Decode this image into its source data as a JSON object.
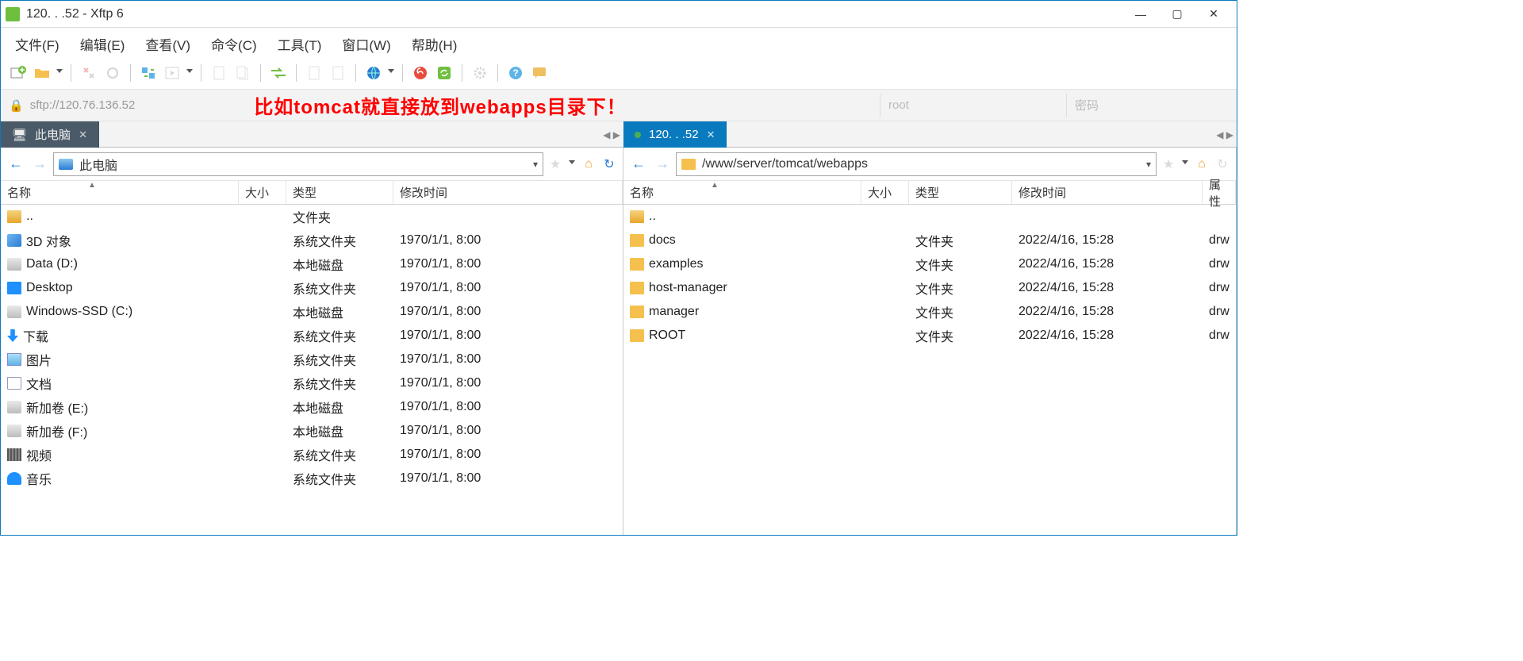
{
  "window": {
    "title": "120.  .  .52 - Xftp 6"
  },
  "menu": [
    "文件(F)",
    "编辑(E)",
    "查看(V)",
    "命令(C)",
    "工具(T)",
    "窗口(W)",
    "帮助(H)"
  ],
  "address": {
    "url": "sftp://120.76.136.52",
    "overlay": "比如tomcat就直接放到webapps目录下！",
    "user_placeholder": "root",
    "pass_placeholder": "密码"
  },
  "tabs": {
    "local": "此电脑",
    "remote": "120.  .  .52"
  },
  "local": {
    "path": "此电脑",
    "cols": {
      "name": "名称",
      "size": "大小",
      "type": "类型",
      "mtime": "修改时间"
    },
    "rows": [
      {
        "icon": "fold-o",
        "name": "..",
        "type": "文件夹",
        "mtime": ""
      },
      {
        "icon": "cube",
        "name": "3D 对象",
        "type": "系统文件夹",
        "mtime": "1970/1/1, 8:00"
      },
      {
        "icon": "hdd",
        "name": "Data (D:)",
        "type": "本地磁盘",
        "mtime": "1970/1/1, 8:00"
      },
      {
        "icon": "desk",
        "name": "Desktop",
        "type": "系统文件夹",
        "mtime": "1970/1/1, 8:00"
      },
      {
        "icon": "hdd",
        "name": "Windows-SSD (C:)",
        "type": "本地磁盘",
        "mtime": "1970/1/1, 8:00"
      },
      {
        "icon": "dl",
        "name": "下载",
        "type": "系统文件夹",
        "mtime": "1970/1/1, 8:00"
      },
      {
        "icon": "img",
        "name": "图片",
        "type": "系统文件夹",
        "mtime": "1970/1/1, 8:00"
      },
      {
        "icon": "doc",
        "name": "文档",
        "type": "系统文件夹",
        "mtime": "1970/1/1, 8:00"
      },
      {
        "icon": "hdd",
        "name": "新加卷 (E:)",
        "type": "本地磁盘",
        "mtime": "1970/1/1, 8:00"
      },
      {
        "icon": "hdd",
        "name": "新加卷 (F:)",
        "type": "本地磁盘",
        "mtime": "1970/1/1, 8:00"
      },
      {
        "icon": "vid",
        "name": "视频",
        "type": "系统文件夹",
        "mtime": "1970/1/1, 8:00"
      },
      {
        "icon": "mus",
        "name": "音乐",
        "type": "系统文件夹",
        "mtime": "1970/1/1, 8:00"
      }
    ]
  },
  "remote": {
    "path": "/www/server/tomcat/webapps",
    "cols": {
      "name": "名称",
      "size": "大小",
      "type": "类型",
      "mtime": "修改时间",
      "attr": "属性"
    },
    "rows": [
      {
        "icon": "fold-o",
        "name": "..",
        "type": "",
        "mtime": "",
        "attr": ""
      },
      {
        "icon": "fold",
        "name": "docs",
        "type": "文件夹",
        "mtime": "2022/4/16, 15:28",
        "attr": "drw"
      },
      {
        "icon": "fold",
        "name": "examples",
        "type": "文件夹",
        "mtime": "2022/4/16, 15:28",
        "attr": "drw"
      },
      {
        "icon": "fold",
        "name": "host-manager",
        "type": "文件夹",
        "mtime": "2022/4/16, 15:28",
        "attr": "drw"
      },
      {
        "icon": "fold",
        "name": "manager",
        "type": "文件夹",
        "mtime": "2022/4/16, 15:28",
        "attr": "drw"
      },
      {
        "icon": "fold",
        "name": "ROOT",
        "type": "文件夹",
        "mtime": "2022/4/16, 15:28",
        "attr": "drw"
      }
    ]
  }
}
